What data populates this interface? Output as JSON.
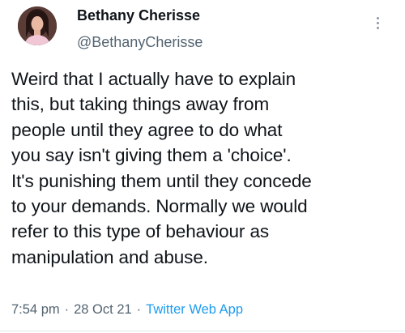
{
  "user": {
    "display_name": "Bethany Cherisse",
    "handle": "@BethanyCherisse"
  },
  "tweet": {
    "text": "Weird that I actually have to explain\nthis, but taking things away from\npeople until they agree to do what\nyou say isn't giving them a 'choice'.\nIt's punishing them until they concede\nto your demands. Normally we would\nrefer to this type of behaviour as\nmanipulation and abuse.",
    "time": "7:54 pm",
    "separator": "·",
    "date": "28 Oct 21",
    "source": "Twitter Web App"
  },
  "icons": {
    "more": "more-options-icon",
    "avatar": "avatar"
  },
  "colors": {
    "text": "#0f1419",
    "secondary": "#536471",
    "link": "#1d9bf0"
  }
}
